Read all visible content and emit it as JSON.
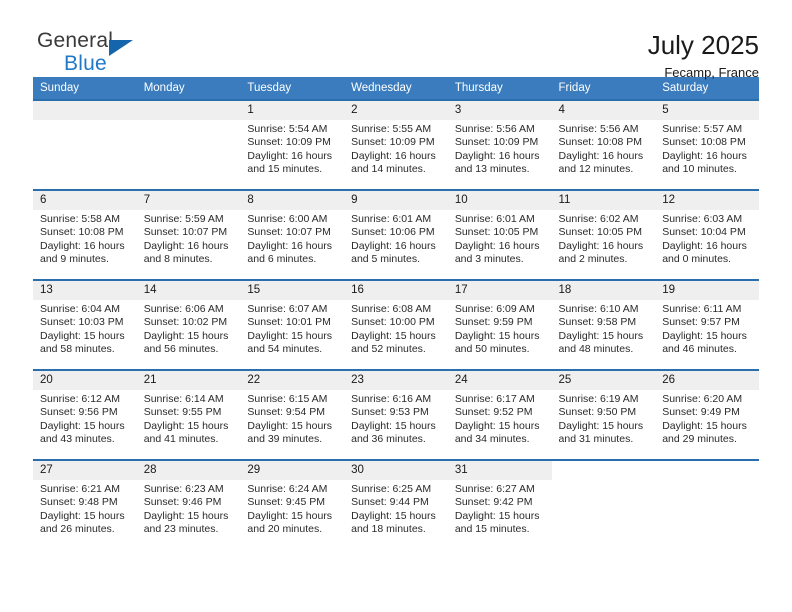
{
  "brand": {
    "name_part1": "General",
    "name_part2": "Blue"
  },
  "header": {
    "title": "July 2025",
    "subtitle": "Fecamp, France"
  },
  "calendar": {
    "weekday_headers": [
      "Sunday",
      "Monday",
      "Tuesday",
      "Wednesday",
      "Thursday",
      "Friday",
      "Saturday"
    ],
    "colors": {
      "header_blue": "#3a7cbe",
      "row_rule_blue": "#2a6ead",
      "daynum_band": "#efefef",
      "brand_blue": "#2079c7"
    },
    "weeks": [
      [
        {
          "day": "",
          "sunrise": "",
          "sunset": "",
          "daylight_line1": "",
          "daylight_line2": ""
        },
        {
          "day": "",
          "sunrise": "",
          "sunset": "",
          "daylight_line1": "",
          "daylight_line2": ""
        },
        {
          "day": "1",
          "sunrise": "Sunrise: 5:54 AM",
          "sunset": "Sunset: 10:09 PM",
          "daylight_line1": "Daylight: 16 hours",
          "daylight_line2": "and 15 minutes."
        },
        {
          "day": "2",
          "sunrise": "Sunrise: 5:55 AM",
          "sunset": "Sunset: 10:09 PM",
          "daylight_line1": "Daylight: 16 hours",
          "daylight_line2": "and 14 minutes."
        },
        {
          "day": "3",
          "sunrise": "Sunrise: 5:56 AM",
          "sunset": "Sunset: 10:09 PM",
          "daylight_line1": "Daylight: 16 hours",
          "daylight_line2": "and 13 minutes."
        },
        {
          "day": "4",
          "sunrise": "Sunrise: 5:56 AM",
          "sunset": "Sunset: 10:08 PM",
          "daylight_line1": "Daylight: 16 hours",
          "daylight_line2": "and 12 minutes."
        },
        {
          "day": "5",
          "sunrise": "Sunrise: 5:57 AM",
          "sunset": "Sunset: 10:08 PM",
          "daylight_line1": "Daylight: 16 hours",
          "daylight_line2": "and 10 minutes."
        }
      ],
      [
        {
          "day": "6",
          "sunrise": "Sunrise: 5:58 AM",
          "sunset": "Sunset: 10:08 PM",
          "daylight_line1": "Daylight: 16 hours",
          "daylight_line2": "and 9 minutes."
        },
        {
          "day": "7",
          "sunrise": "Sunrise: 5:59 AM",
          "sunset": "Sunset: 10:07 PM",
          "daylight_line1": "Daylight: 16 hours",
          "daylight_line2": "and 8 minutes."
        },
        {
          "day": "8",
          "sunrise": "Sunrise: 6:00 AM",
          "sunset": "Sunset: 10:07 PM",
          "daylight_line1": "Daylight: 16 hours",
          "daylight_line2": "and 6 minutes."
        },
        {
          "day": "9",
          "sunrise": "Sunrise: 6:01 AM",
          "sunset": "Sunset: 10:06 PM",
          "daylight_line1": "Daylight: 16 hours",
          "daylight_line2": "and 5 minutes."
        },
        {
          "day": "10",
          "sunrise": "Sunrise: 6:01 AM",
          "sunset": "Sunset: 10:05 PM",
          "daylight_line1": "Daylight: 16 hours",
          "daylight_line2": "and 3 minutes."
        },
        {
          "day": "11",
          "sunrise": "Sunrise: 6:02 AM",
          "sunset": "Sunset: 10:05 PM",
          "daylight_line1": "Daylight: 16 hours",
          "daylight_line2": "and 2 minutes."
        },
        {
          "day": "12",
          "sunrise": "Sunrise: 6:03 AM",
          "sunset": "Sunset: 10:04 PM",
          "daylight_line1": "Daylight: 16 hours",
          "daylight_line2": "and 0 minutes."
        }
      ],
      [
        {
          "day": "13",
          "sunrise": "Sunrise: 6:04 AM",
          "sunset": "Sunset: 10:03 PM",
          "daylight_line1": "Daylight: 15 hours",
          "daylight_line2": "and 58 minutes."
        },
        {
          "day": "14",
          "sunrise": "Sunrise: 6:06 AM",
          "sunset": "Sunset: 10:02 PM",
          "daylight_line1": "Daylight: 15 hours",
          "daylight_line2": "and 56 minutes."
        },
        {
          "day": "15",
          "sunrise": "Sunrise: 6:07 AM",
          "sunset": "Sunset: 10:01 PM",
          "daylight_line1": "Daylight: 15 hours",
          "daylight_line2": "and 54 minutes."
        },
        {
          "day": "16",
          "sunrise": "Sunrise: 6:08 AM",
          "sunset": "Sunset: 10:00 PM",
          "daylight_line1": "Daylight: 15 hours",
          "daylight_line2": "and 52 minutes."
        },
        {
          "day": "17",
          "sunrise": "Sunrise: 6:09 AM",
          "sunset": "Sunset: 9:59 PM",
          "daylight_line1": "Daylight: 15 hours",
          "daylight_line2": "and 50 minutes."
        },
        {
          "day": "18",
          "sunrise": "Sunrise: 6:10 AM",
          "sunset": "Sunset: 9:58 PM",
          "daylight_line1": "Daylight: 15 hours",
          "daylight_line2": "and 48 minutes."
        },
        {
          "day": "19",
          "sunrise": "Sunrise: 6:11 AM",
          "sunset": "Sunset: 9:57 PM",
          "daylight_line1": "Daylight: 15 hours",
          "daylight_line2": "and 46 minutes."
        }
      ],
      [
        {
          "day": "20",
          "sunrise": "Sunrise: 6:12 AM",
          "sunset": "Sunset: 9:56 PM",
          "daylight_line1": "Daylight: 15 hours",
          "daylight_line2": "and 43 minutes."
        },
        {
          "day": "21",
          "sunrise": "Sunrise: 6:14 AM",
          "sunset": "Sunset: 9:55 PM",
          "daylight_line1": "Daylight: 15 hours",
          "daylight_line2": "and 41 minutes."
        },
        {
          "day": "22",
          "sunrise": "Sunrise: 6:15 AM",
          "sunset": "Sunset: 9:54 PM",
          "daylight_line1": "Daylight: 15 hours",
          "daylight_line2": "and 39 minutes."
        },
        {
          "day": "23",
          "sunrise": "Sunrise: 6:16 AM",
          "sunset": "Sunset: 9:53 PM",
          "daylight_line1": "Daylight: 15 hours",
          "daylight_line2": "and 36 minutes."
        },
        {
          "day": "24",
          "sunrise": "Sunrise: 6:17 AM",
          "sunset": "Sunset: 9:52 PM",
          "daylight_line1": "Daylight: 15 hours",
          "daylight_line2": "and 34 minutes."
        },
        {
          "day": "25",
          "sunrise": "Sunrise: 6:19 AM",
          "sunset": "Sunset: 9:50 PM",
          "daylight_line1": "Daylight: 15 hours",
          "daylight_line2": "and 31 minutes."
        },
        {
          "day": "26",
          "sunrise": "Sunrise: 6:20 AM",
          "sunset": "Sunset: 9:49 PM",
          "daylight_line1": "Daylight: 15 hours",
          "daylight_line2": "and 29 minutes."
        }
      ],
      [
        {
          "day": "27",
          "sunrise": "Sunrise: 6:21 AM",
          "sunset": "Sunset: 9:48 PM",
          "daylight_line1": "Daylight: 15 hours",
          "daylight_line2": "and 26 minutes."
        },
        {
          "day": "28",
          "sunrise": "Sunrise: 6:23 AM",
          "sunset": "Sunset: 9:46 PM",
          "daylight_line1": "Daylight: 15 hours",
          "daylight_line2": "and 23 minutes."
        },
        {
          "day": "29",
          "sunrise": "Sunrise: 6:24 AM",
          "sunset": "Sunset: 9:45 PM",
          "daylight_line1": "Daylight: 15 hours",
          "daylight_line2": "and 20 minutes."
        },
        {
          "day": "30",
          "sunrise": "Sunrise: 6:25 AM",
          "sunset": "Sunset: 9:44 PM",
          "daylight_line1": "Daylight: 15 hours",
          "daylight_line2": "and 18 minutes."
        },
        {
          "day": "31",
          "sunrise": "Sunrise: 6:27 AM",
          "sunset": "Sunset: 9:42 PM",
          "daylight_line1": "Daylight: 15 hours",
          "daylight_line2": "and 15 minutes."
        },
        {
          "day": "",
          "sunrise": "",
          "sunset": "",
          "daylight_line1": "",
          "daylight_line2": ""
        },
        {
          "day": "",
          "sunrise": "",
          "sunset": "",
          "daylight_line1": "",
          "daylight_line2": ""
        }
      ]
    ]
  }
}
